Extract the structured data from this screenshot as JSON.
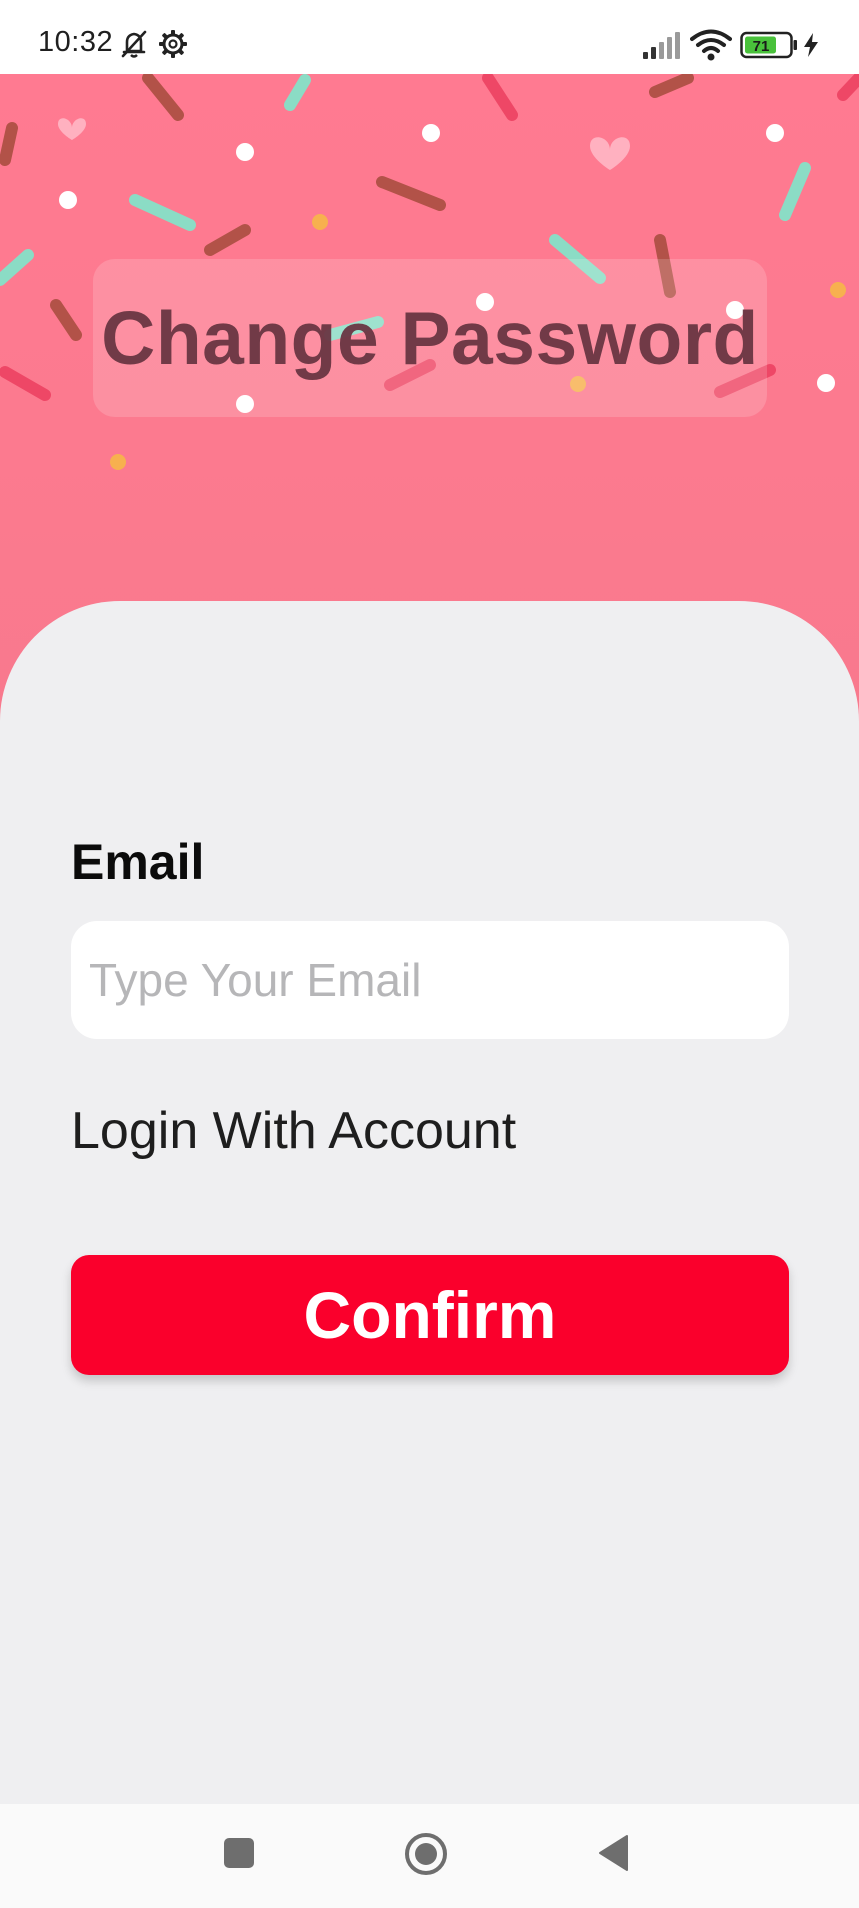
{
  "status_bar": {
    "time": "10:32",
    "battery_level": "71",
    "icons": [
      "bell-off-icon",
      "gear-icon",
      "signal-icon",
      "wifi-icon",
      "battery-icon",
      "charging-icon"
    ]
  },
  "hero": {
    "title": "Change Password",
    "background_color": "#ff7a91"
  },
  "form": {
    "email_label": "Email",
    "email_placeholder": "Type Your Email",
    "email_value": "",
    "login_link": "Login With Account",
    "confirm_label": "Confirm"
  },
  "nav_bar": {
    "buttons": [
      "recents-square-icon",
      "home-circle-icon",
      "back-triangle-icon"
    ]
  },
  "colors": {
    "accent": "#fa002c",
    "sheet": "#efeff1",
    "title_text": "#6a3643"
  }
}
